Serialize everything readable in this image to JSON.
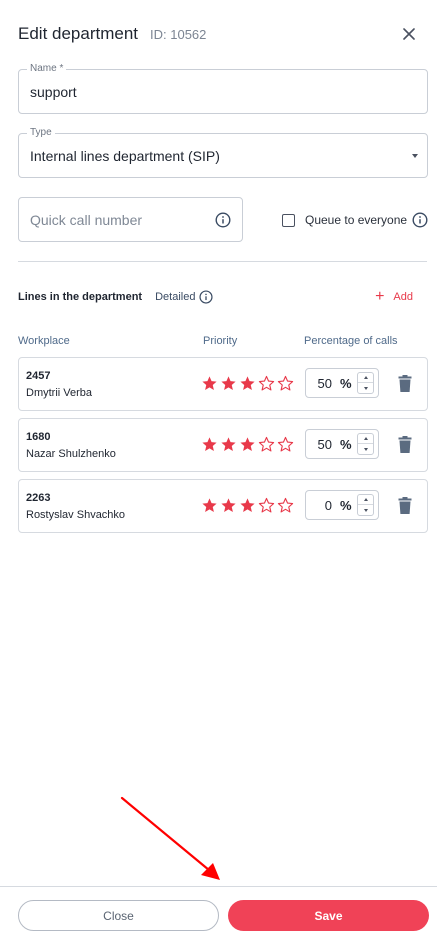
{
  "header": {
    "title": "Edit department",
    "id_text": "ID: 10562"
  },
  "name_field": {
    "label": "Name *",
    "value": "support"
  },
  "type_field": {
    "label": "Type",
    "value": "Internal lines department (SIP)"
  },
  "quick_call": {
    "placeholder": "Quick call number"
  },
  "queue": {
    "label": "Queue to everyone",
    "checked": false
  },
  "lines": {
    "title": "Lines in the department",
    "detailed_label": "Detailed",
    "add_label": "Add",
    "columns": {
      "workplace": "Workplace",
      "priority": "Priority",
      "percent": "Percentage of calls"
    },
    "rows": [
      {
        "ext": "2457",
        "name": "Dmytrii Verba",
        "stars": 3,
        "max_stars": 5,
        "percent": "50",
        "unit": "%"
      },
      {
        "ext": "1680",
        "name": "Nazar Shulzhenko",
        "stars": 3,
        "max_stars": 5,
        "percent": "50",
        "unit": "%"
      },
      {
        "ext": "2263",
        "name": "Rostyslav Shvachko",
        "stars": 3,
        "max_stars": 5,
        "percent": "0",
        "unit": "%"
      }
    ]
  },
  "footer": {
    "close_label": "Close",
    "save_label": "Save"
  },
  "colors": {
    "accent": "#f04257",
    "star": "#e8394a",
    "border": "#c9ced6",
    "arrow": "#ff0000"
  }
}
